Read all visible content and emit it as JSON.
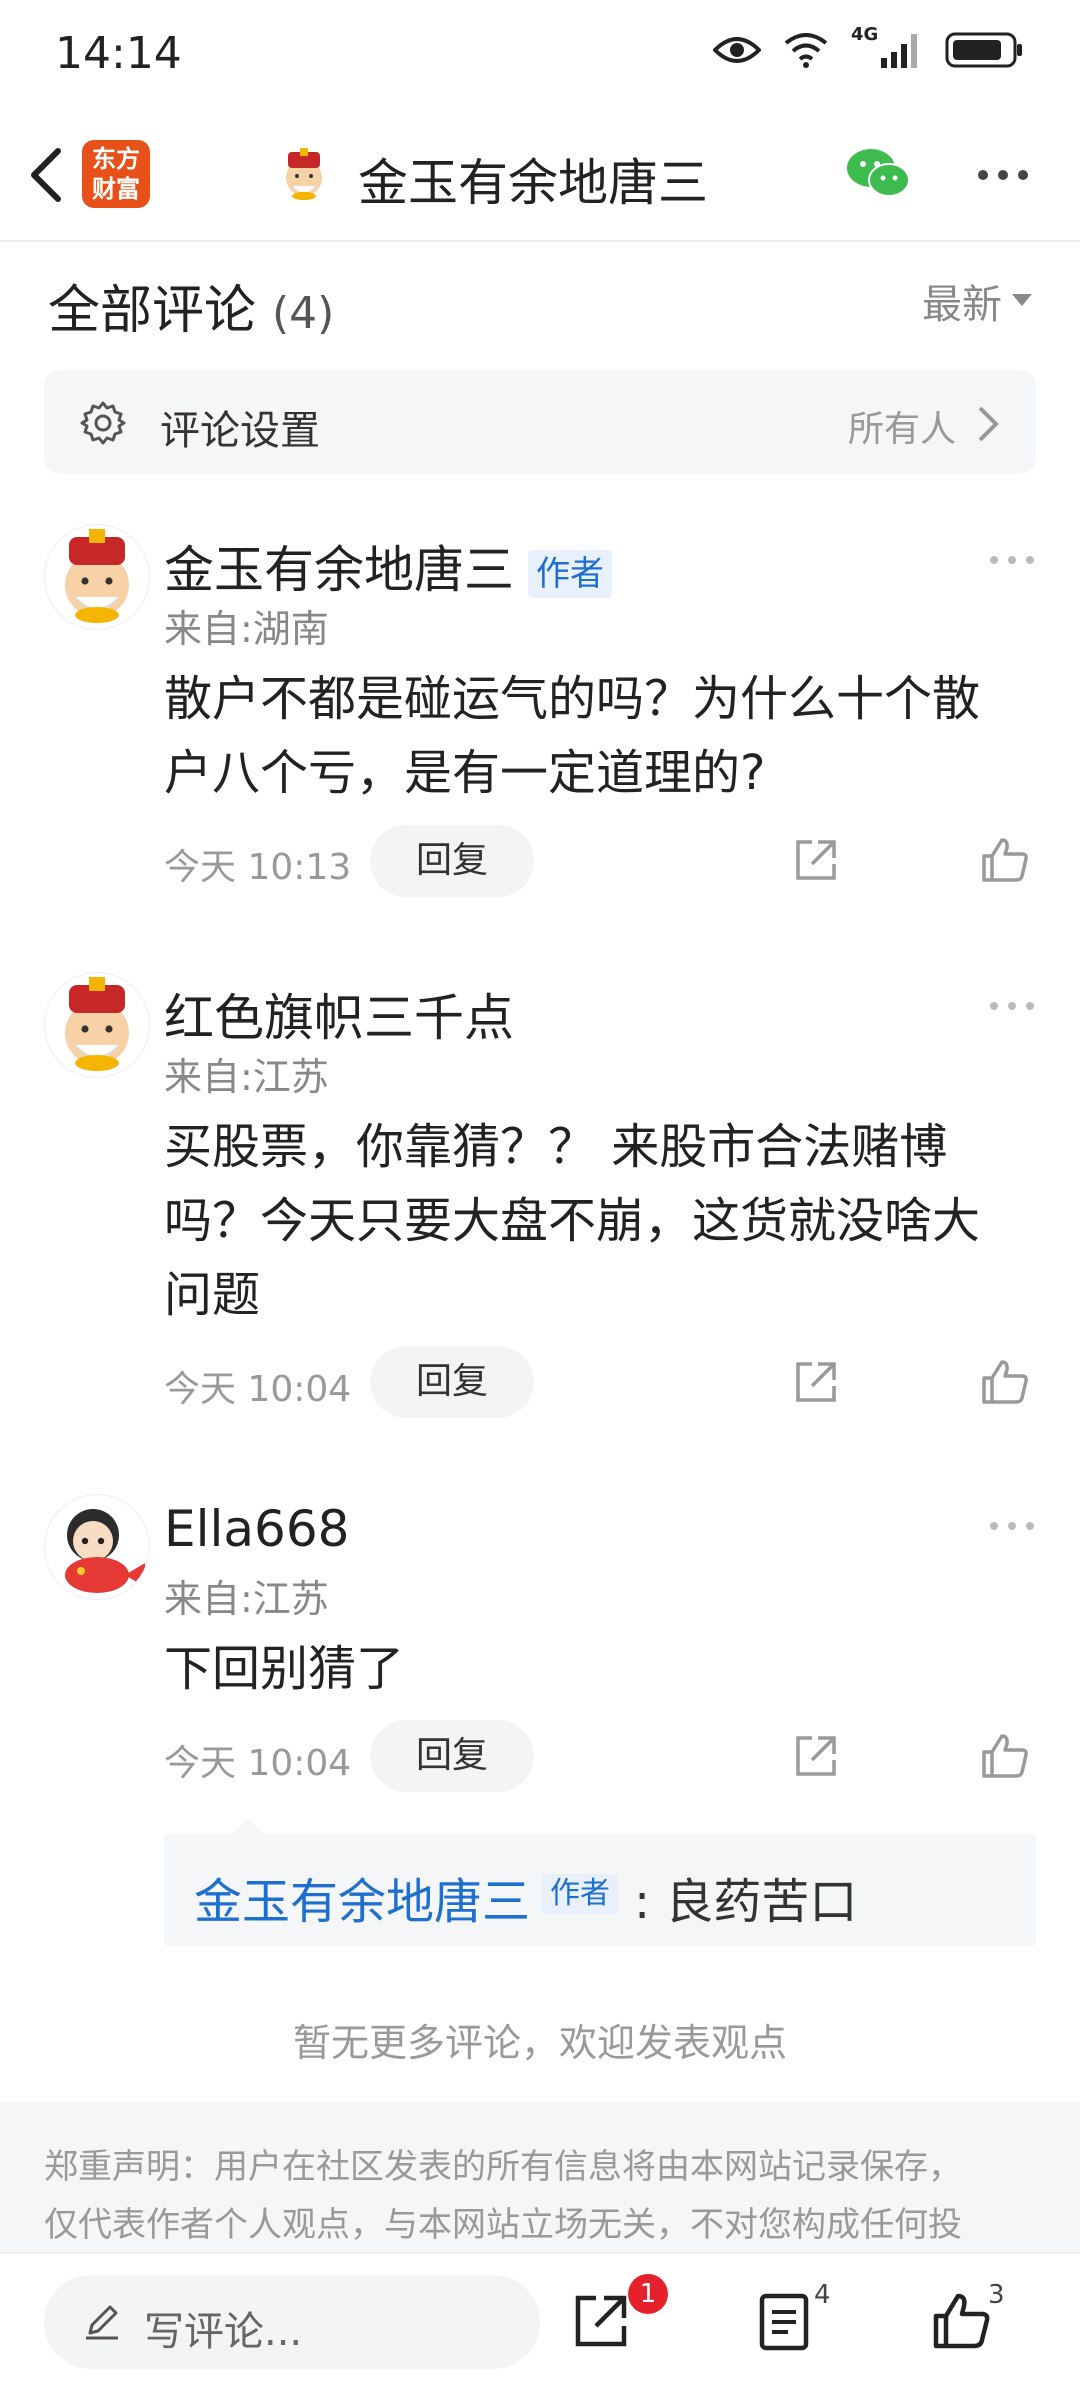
{
  "status_bar": {
    "time": "14:14",
    "network": "4G"
  },
  "nav": {
    "logo_text_line1": "东方",
    "logo_text_line2": "财富",
    "title": "金玉有余地唐三"
  },
  "header": {
    "title": "全部评论",
    "count": "(4)",
    "sort_label": "最新"
  },
  "settings": {
    "label": "评论设置",
    "value": "所有人"
  },
  "comments": [
    {
      "name": "金玉有余地唐三",
      "badge": "作者",
      "location": "来自:湖南",
      "text_line1": "散户不都是碰运气的吗？为什么十个散",
      "text_line2": "户八个亏，是有一定道理的?",
      "time": "今天 10:13",
      "reply_label": "回复"
    },
    {
      "name": "红色旗帜三千点",
      "location": "来自:江苏",
      "text_line1": "买股票，你靠猜？？ 来股市合法赌博",
      "text_line2": "吗？今天只要大盘不崩，这货就没啥大",
      "text_line3": "问题",
      "time": "今天 10:04",
      "reply_label": "回复"
    },
    {
      "name": "Ella668",
      "location": "来自:江苏",
      "text_line1": "下回别猜了",
      "time": "今天 10:04",
      "reply_label": "回复",
      "nested_reply": {
        "name": "金玉有余地唐三",
        "badge": "作者",
        "text": ": 良药苦口"
      }
    }
  ],
  "no_more": "暂无更多评论，欢迎发表观点",
  "disclaimer": {
    "line1": "郑重声明：用户在社区发表的所有信息将由本网站记录保存，",
    "line2": "仅代表作者个人观点，与本网站立场无关，不对您构成任何投"
  },
  "bottom_bar": {
    "write_placeholder": "写评论...",
    "share_badge": "1",
    "list_count": "4",
    "like_count": "3"
  },
  "colors": {
    "accent_blue": "#1f6fd1",
    "brand_orange": "#e8501a",
    "badge_red": "#e5222c",
    "wechat_green": "#3dbb4e"
  }
}
